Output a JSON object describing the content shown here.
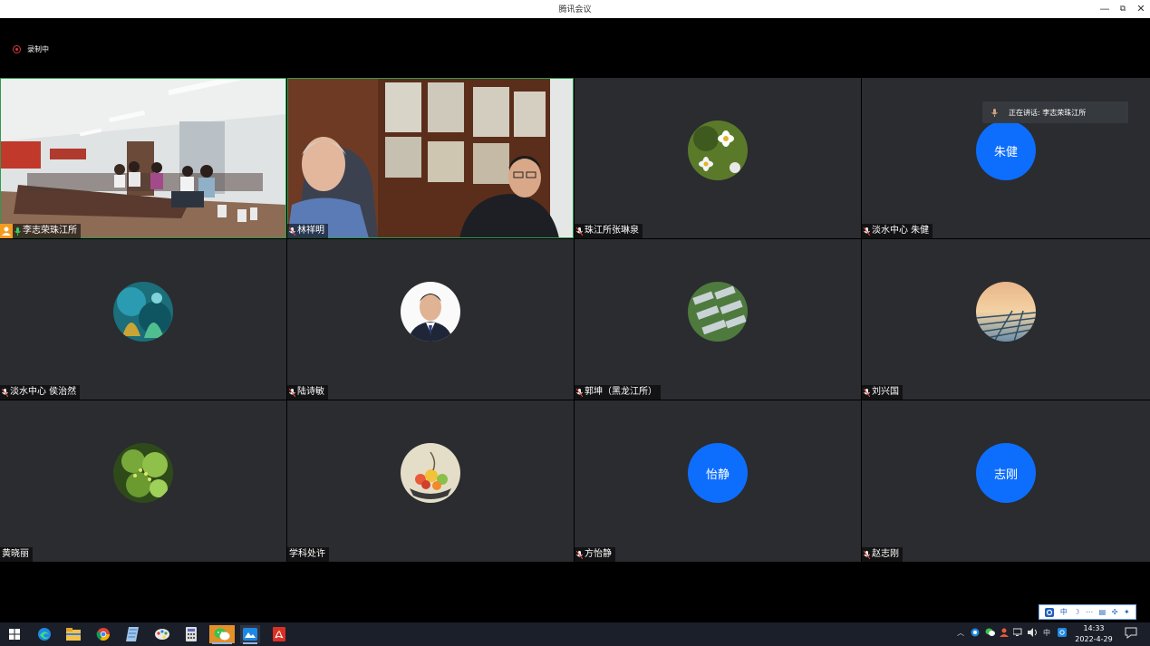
{
  "window": {
    "title": "腾讯会议",
    "minimize": "—",
    "restore": "⧉",
    "close": "✕"
  },
  "recording": {
    "label": "录制中"
  },
  "speaking_toast": {
    "text": "正在讲话: 李志荣珠江所"
  },
  "participants": [
    {
      "name": "李志荣珠江所",
      "kind": "video",
      "host": true
    },
    {
      "name": "林祥明",
      "kind": "video"
    },
    {
      "name": "珠江所张琳泉",
      "kind": "avatar-image",
      "icon": "flower-avatar"
    },
    {
      "name": "淡水中心 朱健",
      "kind": "avatar-text",
      "avatar_text": "朱健"
    },
    {
      "name": "淡水中心 侯治然",
      "kind": "avatar-image",
      "icon": "coral-avatar"
    },
    {
      "name": "陆诗敏",
      "kind": "avatar-image",
      "icon": "portrait-avatar"
    },
    {
      "name": "郭坤（黑龙江所）",
      "kind": "avatar-image",
      "icon": "greenhouse-avatar"
    },
    {
      "name": "刘兴国",
      "kind": "avatar-image",
      "icon": "sunset-avatar"
    },
    {
      "name": "黄晓丽",
      "kind": "avatar-image",
      "icon": "plant-avatar"
    },
    {
      "name": "学科处许",
      "kind": "avatar-image",
      "icon": "fruit-avatar"
    },
    {
      "name": "方怡静",
      "kind": "avatar-text",
      "avatar_text": "怡静"
    },
    {
      "name": "赵志刚",
      "kind": "avatar-text",
      "avatar_text": "志刚"
    }
  ],
  "ime": {
    "items": [
      "中",
      "☽",
      "⋯",
      "▤",
      "✣",
      "✦"
    ]
  },
  "taskbar": {
    "apps": [
      "start-icon",
      "edge-icon",
      "file-explorer-icon",
      "chrome-icon",
      "notes-icon",
      "paint-icon",
      "calculator-icon",
      "wechat-icon",
      "photos-icon",
      "pdf-icon"
    ],
    "tray": {
      "ime_label": "中"
    },
    "clock": {
      "time": "14:33",
      "date": "2022-4-29"
    }
  },
  "colors": {
    "accent": "#0d6efd",
    "tile": "#2a2c30",
    "speaking": "#2f9b4e",
    "recording": "#d9343b"
  }
}
